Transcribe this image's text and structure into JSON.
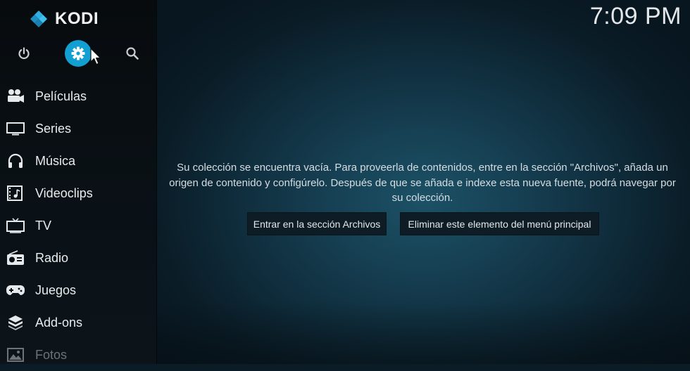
{
  "app": {
    "logo_text": "KODI"
  },
  "clock": {
    "time": "7:09 PM"
  },
  "topbar": {
    "power_icon": "power-icon",
    "settings_icon": "gear-icon",
    "search_icon": "search-icon"
  },
  "sidebar": {
    "items": [
      {
        "label": "Películas",
        "icon": "movie-camera-icon"
      },
      {
        "label": "Series",
        "icon": "tv-monitor-icon"
      },
      {
        "label": "Música",
        "icon": "headphones-icon"
      },
      {
        "label": "Videoclips",
        "icon": "film-note-icon"
      },
      {
        "label": "TV",
        "icon": "tv-icon"
      },
      {
        "label": "Radio",
        "icon": "radio-icon"
      },
      {
        "label": "Juegos",
        "icon": "gamepad-icon"
      },
      {
        "label": "Add-ons",
        "icon": "addons-box-icon"
      },
      {
        "label": "Fotos",
        "icon": "photo-icon"
      }
    ]
  },
  "main": {
    "message": "Su colección se encuentra vacía. Para proveerla de contenidos, entre en la sección \"Archivos\", añada un origen de contenido y configúrelo. Después de que se añada e indexe esta nueva fuente, podrá navegar por su colección.",
    "button_files": "Entrar en la sección Archivos",
    "button_remove": "Eliminar este elemento del menú principal"
  },
  "colors": {
    "accent": "#12a0d3",
    "sidebar_bg": "#090e12",
    "main_bg": "#163f52"
  }
}
